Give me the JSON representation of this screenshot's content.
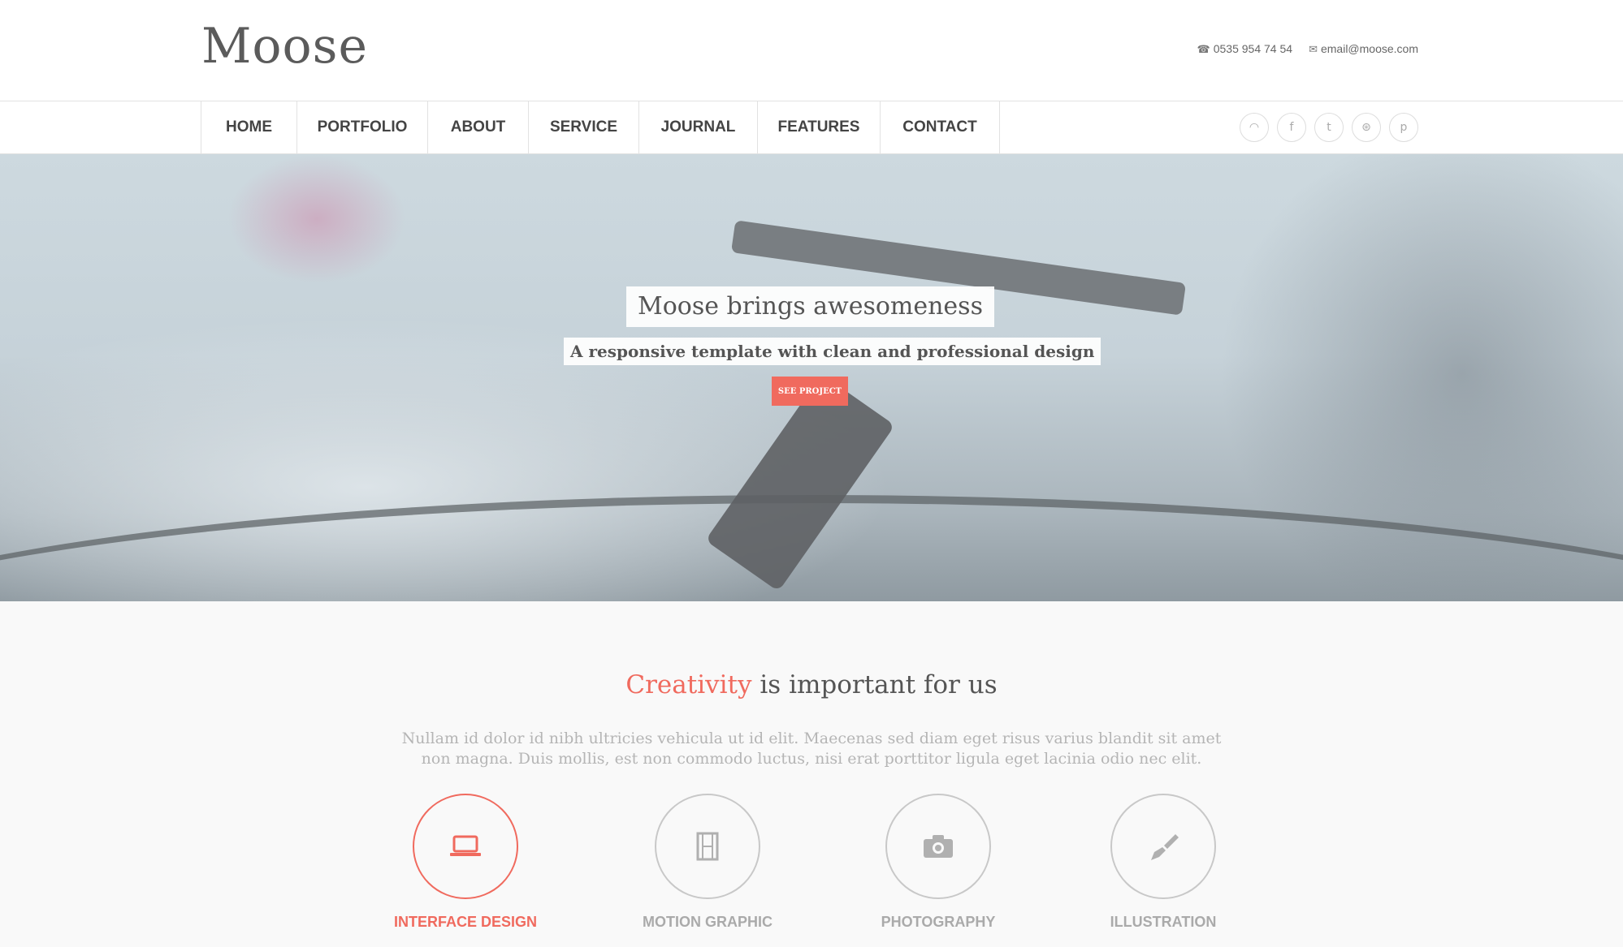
{
  "header": {
    "logo": "Moose",
    "phone_icon": "☎",
    "phone": "0535 954 74 54",
    "email_icon": "✉",
    "email": "email@moose.com"
  },
  "nav": {
    "items": [
      {
        "label": "HOME"
      },
      {
        "label": "PORTFOLIO"
      },
      {
        "label": "ABOUT"
      },
      {
        "label": "SERVICE"
      },
      {
        "label": "JOURNAL"
      },
      {
        "label": "FEATURES"
      },
      {
        "label": "CONTACT"
      }
    ]
  },
  "social": {
    "items": [
      {
        "icon": "rss-icon",
        "glyph": "◠"
      },
      {
        "icon": "facebook-icon",
        "glyph": "f"
      },
      {
        "icon": "twitter-icon",
        "glyph": "t"
      },
      {
        "icon": "dribbble-icon",
        "glyph": "⊛"
      },
      {
        "icon": "pinterest-icon",
        "glyph": "p"
      }
    ]
  },
  "hero": {
    "title": "Moose brings awesomeness",
    "subtitle": "A responsive template with clean and professional design",
    "button": "SEE PROJECT"
  },
  "services": {
    "title_accent": "Creativity",
    "title_rest": " is important for us",
    "description": "Nullam id dolor id nibh ultricies vehicula ut id elit. Maecenas sed diam eget risus varius blandit sit amet non magna. Duis mollis, est non commodo luctus, nisi erat porttitor ligula eget lacinia odio nec elit.",
    "items": [
      {
        "label": "INTERFACE DESIGN",
        "icon": "laptop-icon",
        "glyph": "💻"
      },
      {
        "label": "MOTION GRAPHIC",
        "icon": "film-icon",
        "glyph": "🎞"
      },
      {
        "label": "PHOTOGRAPHY",
        "icon": "camera-icon",
        "glyph": "📷"
      },
      {
        "label": "ILLUSTRATION",
        "icon": "brush-icon",
        "glyph": "🖌"
      }
    ],
    "accent_color": "#f06a5e"
  }
}
